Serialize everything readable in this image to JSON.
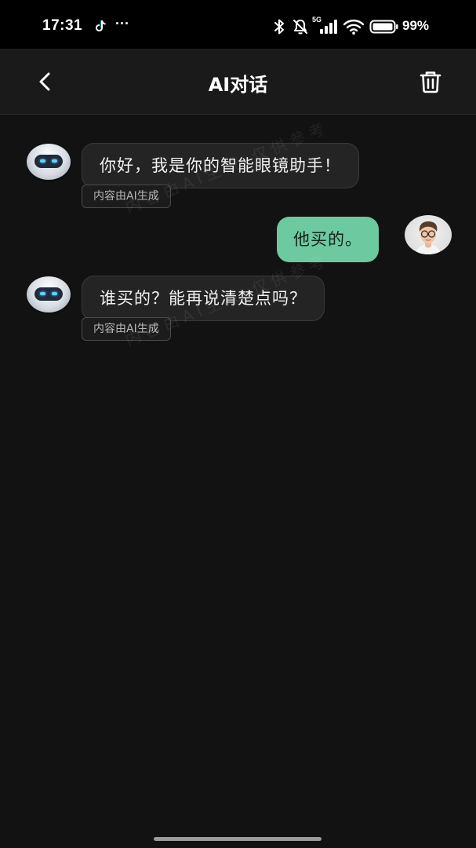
{
  "status_bar": {
    "time": "17:31",
    "more": "···",
    "battery": "99%",
    "network": "5G",
    "icons": [
      "tiktok-icon",
      "bluetooth-icon",
      "mute-icon",
      "signal-icon",
      "wifi-icon",
      "battery-icon"
    ]
  },
  "header": {
    "title": "AI对话",
    "back_icon": "chevron-left-icon",
    "delete_icon": "trash-icon"
  },
  "messages": [
    {
      "role": "assistant",
      "text": "你好，我是你的智能眼镜助手！",
      "tag": "内容由AI生成"
    },
    {
      "role": "user",
      "text": "他买的。"
    },
    {
      "role": "assistant",
      "text": "谁买的？能再说清楚点吗？",
      "tag": "内容由AI生成"
    }
  ],
  "watermark": "内容由AI生成 仅供参考",
  "colors": {
    "background": "#121212",
    "header": "#1a1a1a",
    "ai_bubble": "#242424",
    "user_bubble": "#6cc9a0",
    "status_bar": "#000000"
  }
}
